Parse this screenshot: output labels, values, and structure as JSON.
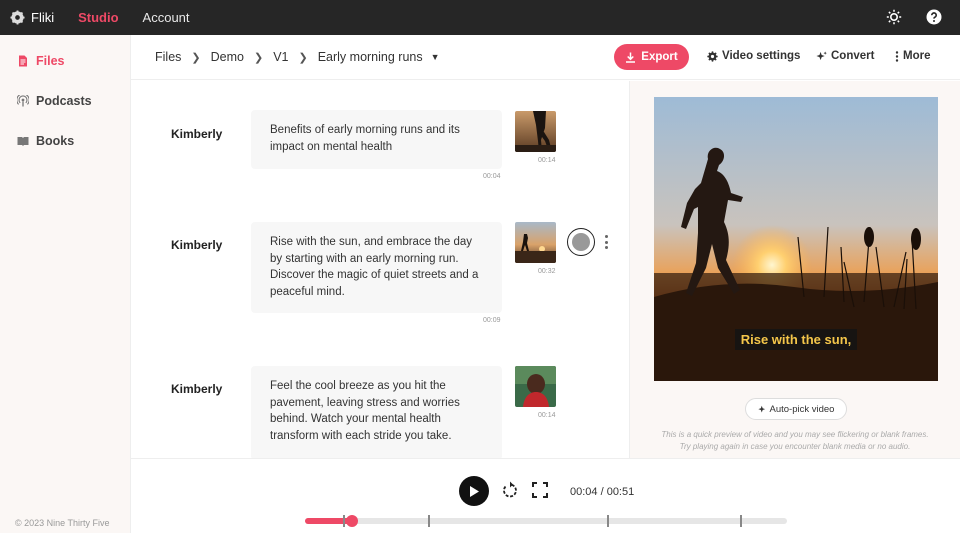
{
  "topbar": {
    "logo_label": "Fliki",
    "nav": [
      "Studio",
      "Account"
    ],
    "icons": [
      "sun-icon",
      "help-icon"
    ]
  },
  "sidebar": {
    "items": [
      {
        "label": "Files",
        "icon": "file-icon",
        "active": true
      },
      {
        "label": "Podcasts",
        "icon": "podcast-icon",
        "active": false
      },
      {
        "label": "Books",
        "icon": "book-icon",
        "active": false
      }
    ],
    "copyright": "© 2023 Nine Thirty Five"
  },
  "header": {
    "breadcrumbs": [
      "Files",
      "Demo",
      "V1",
      "Early morning runs"
    ],
    "export_label": "Export",
    "video_settings_label": "Video settings",
    "convert_label": "Convert",
    "more_label": "More"
  },
  "scenes": [
    {
      "speaker": "Kimberly",
      "text": "Benefits of early morning runs and its impact on mental health",
      "text_time": "00:04",
      "media_time": "00:14"
    },
    {
      "speaker": "Kimberly",
      "text": "Rise with the sun, and embrace the day by starting with an early morning run. Discover the magic of quiet streets and a peaceful mind.",
      "text_time": "00:09",
      "media_time": "00:32"
    },
    {
      "speaker": "Kimberly",
      "text": "Feel the cool breeze as you hit the pavement, leaving stress and worries behind. Watch your mental health transform with each stride you take.",
      "text_time": "",
      "media_time": "00:14"
    }
  ],
  "preview": {
    "caption": "Rise with the sun,",
    "auto_pick_label": "Auto-pick video",
    "note_line1": "This is a quick preview of video and you may see flickering or blank frames.",
    "note_line2": "Try playing again in case you encounter blank media or no audio."
  },
  "player": {
    "time": "00:04 / 00:51",
    "progress_fraction": 0.098,
    "scene_marks_seconds": [
      4,
      13,
      32,
      46
    ]
  },
  "colors": {
    "accent": "#ee4966",
    "topbar": "#262626",
    "caption_text": "#f4c64a"
  }
}
